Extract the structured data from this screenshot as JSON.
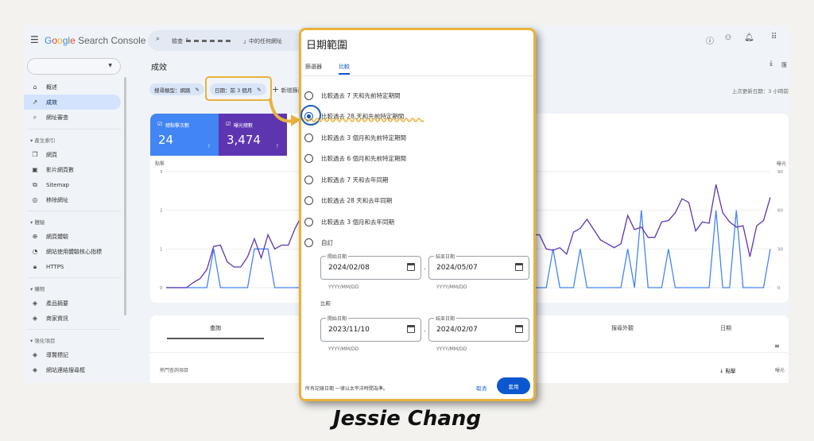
{
  "header": {
    "logo": "Google Search Console",
    "search_prefix": "檢查「",
    "search_suffix": "」中的任何網址"
  },
  "sidebar": {
    "items": [
      {
        "label": "概述",
        "icon": "home-icon"
      },
      {
        "label": "成效",
        "icon": "trending-icon",
        "selected": true
      },
      {
        "label": "網址審查",
        "icon": "search-icon"
      }
    ],
    "sections": [
      {
        "title": "產生索引",
        "items": [
          {
            "label": "網頁",
            "icon": "pages-icon"
          },
          {
            "label": "影片網頁數",
            "icon": "video-icon"
          },
          {
            "label": "Sitemap",
            "icon": "sitemap-icon"
          },
          {
            "label": "移除網址",
            "icon": "eye-off-icon"
          }
        ]
      },
      {
        "title": "體驗",
        "items": [
          {
            "label": "網頁體驗",
            "icon": "plus-circle-icon"
          },
          {
            "label": "網站使用體驗核心指標",
            "icon": "speed-icon"
          },
          {
            "label": "HTTPS",
            "icon": "lock-icon"
          }
        ]
      },
      {
        "title": "購物",
        "items": [
          {
            "label": "產品摘要",
            "icon": "layers-icon"
          },
          {
            "label": "商家資訊",
            "icon": "layers-icon"
          }
        ]
      },
      {
        "title": "強化項目",
        "items": [
          {
            "label": "導覽標記",
            "icon": "layers-icon"
          },
          {
            "label": "網站連結搜尋框",
            "icon": "layers-icon"
          }
        ]
      }
    ]
  },
  "main": {
    "title": "成效",
    "filters": [
      "搜尋類型：網路",
      "日期：前 3 個月"
    ],
    "add_filter": "新增篩選",
    "last_updated": "上次更新日期：3 小時前",
    "export": "匯",
    "metrics": [
      {
        "label": "總點擊次數",
        "value": "24",
        "color": "#4285f4"
      },
      {
        "label": "曝光總數",
        "value": "3,474",
        "color": "#5e35b1"
      }
    ],
    "table": {
      "tabs": [
        "查詢",
        "搜尋外觀",
        "日期"
      ],
      "row_label": "熱門查詢項目",
      "col_clicks": "點擊",
      "col_impr": "曝光"
    }
  },
  "chart_data": {
    "type": "line",
    "left_axis": {
      "label": "點擊",
      "ticks": [
        "3",
        "2",
        "1",
        "0"
      ],
      "range": [
        0,
        3
      ]
    },
    "right_axis": {
      "label": "曝光",
      "ticks": [
        "90",
        "60",
        "30",
        "0"
      ],
      "range": [
        0,
        90
      ]
    },
    "grid": true,
    "series": [
      {
        "color": "#4285f4",
        "axis": "left",
        "values": [
          0,
          0,
          0,
          0,
          0,
          0,
          0,
          1,
          0,
          0,
          0,
          0,
          0,
          1,
          1,
          1,
          0,
          0,
          0,
          0,
          0,
          0,
          0,
          0,
          0,
          0,
          0,
          0,
          0,
          0,
          1,
          0,
          0,
          0,
          0,
          0,
          0,
          0,
          0,
          0,
          0,
          0,
          0,
          0,
          0,
          2,
          0,
          0,
          0,
          0,
          0,
          0,
          0,
          0,
          0,
          0,
          0,
          1,
          0,
          0,
          0,
          1,
          0,
          0,
          0,
          0,
          0,
          0,
          1,
          0,
          2,
          0,
          0,
          0,
          1,
          0,
          0,
          0,
          0,
          0,
          0,
          2,
          0,
          0,
          2,
          0,
          0,
          0,
          0,
          1
        ]
      },
      {
        "color": "#5e35b1",
        "axis": "right",
        "values": [
          0,
          0,
          0,
          0,
          4,
          7,
          14,
          32,
          33,
          20,
          16,
          16,
          24,
          38,
          23,
          41,
          30,
          33,
          33,
          46,
          56,
          48,
          42,
          38,
          44,
          50,
          46,
          40,
          36,
          42,
          48,
          52,
          45,
          40,
          38,
          44,
          50,
          55,
          48,
          42,
          46,
          52,
          50,
          44,
          40,
          38,
          42,
          48,
          53,
          50,
          46,
          44,
          48,
          45,
          41,
          41,
          30,
          29,
          31,
          26,
          43,
          46,
          53,
          45,
          37,
          34,
          31,
          34,
          56,
          45,
          47,
          39,
          39,
          51,
          52,
          58,
          69,
          66,
          44,
          51,
          50,
          80,
          58,
          51,
          47,
          48,
          24,
          48,
          52,
          70
        ]
      }
    ]
  },
  "modal": {
    "title": "日期範圍",
    "tabs": [
      "篩選器",
      "比較"
    ],
    "options": [
      "比較過去 7 天和先前特定期間",
      "比較過去 28 天和先前特定期間",
      "比較過去 3 個月和先前特定期間",
      "比較過去 6 個月和先前特定期間",
      "比較過去 7 天和去年同期",
      "比較過去 28 天和去年同期",
      "比較過去 3 個月和去年同期",
      "自訂"
    ],
    "selected_index": 1,
    "start_label": "開始日期",
    "end_label": "結束日期",
    "format": "YYYY/MM/DD",
    "range": {
      "start": "2024/02/08",
      "end": "2024/05/07"
    },
    "compare_label": "比較",
    "compare": {
      "start": "2023/11/10",
      "end": "2024/02/07"
    },
    "footnote": "所有記錄日期 一律以太平洋時間為準。",
    "cancel": "取消",
    "apply": "套用"
  },
  "caption": "Jessie Chang",
  "colors": {
    "accent": "#0b57d0",
    "highlight": "#e9b23d",
    "background": "#f3f2ef"
  }
}
